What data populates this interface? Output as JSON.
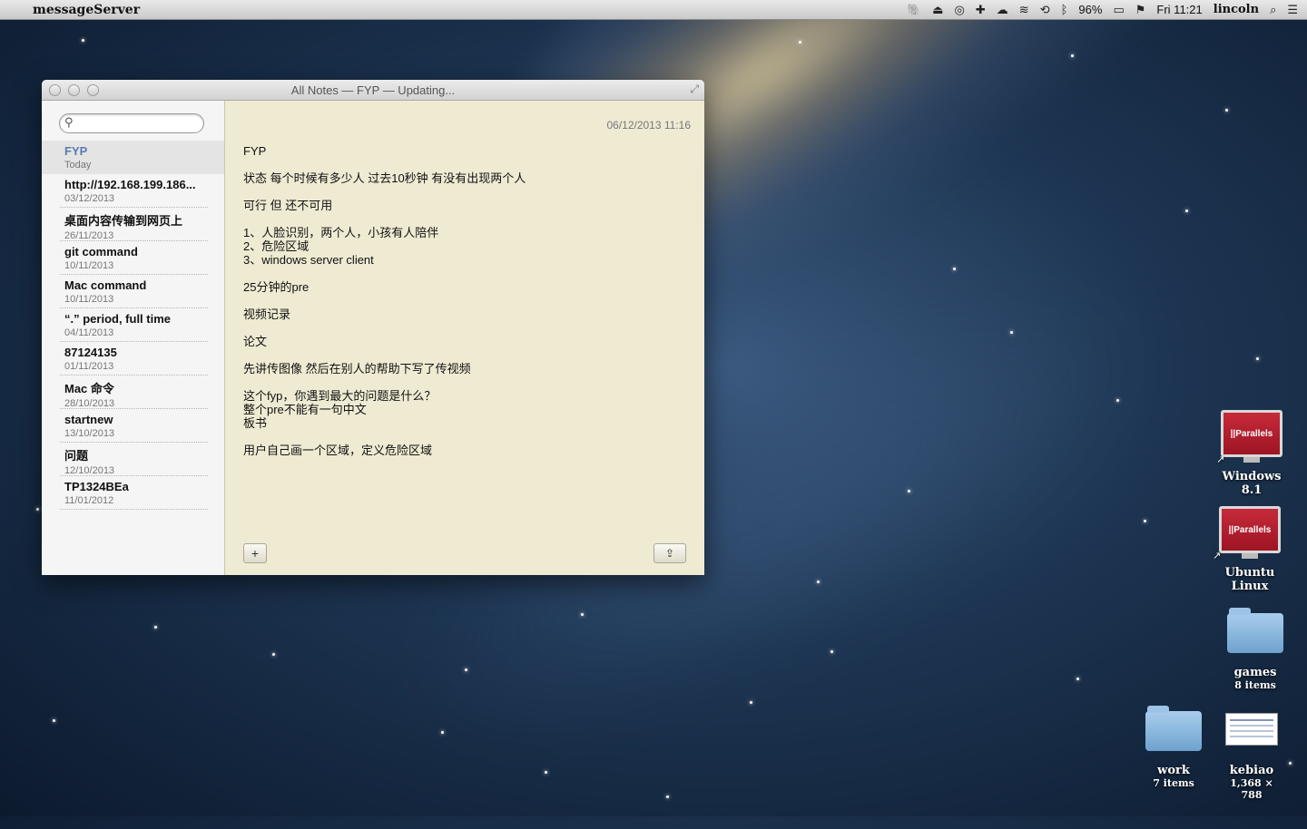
{
  "menubar": {
    "app_name": "messageServer",
    "battery": "96%",
    "clock": "Fri 11:21",
    "user": "lincoln"
  },
  "window": {
    "title": "All Notes — FYP — Updating...",
    "search_placeholder": "",
    "notes": [
      {
        "title": "FYP",
        "date": "Today"
      },
      {
        "title": "http://192.168.199.186...",
        "date": "03/12/2013"
      },
      {
        "title": "桌面内容传输到网页上",
        "date": "26/11/2013"
      },
      {
        "title": "git command",
        "date": "10/11/2013"
      },
      {
        "title": "Mac command",
        "date": "10/11/2013"
      },
      {
        "title": "“.” period, full time",
        "date": "04/11/2013"
      },
      {
        "title": "87124135",
        "date": "01/11/2013"
      },
      {
        "title": "Mac 命令",
        "date": "28/10/2013"
      },
      {
        "title": "startnew",
        "date": "13/10/2013"
      },
      {
        "title": "问题",
        "date": "12/10/2013"
      },
      {
        "title": "TP1324BEa",
        "date": "11/01/2012"
      }
    ],
    "note_timestamp": "06/12/2013 11:16",
    "note_lines": [
      "FYP",
      "",
      "状态 每个时候有多少人 过去10秒钟 有没有出现两个人",
      "",
      "可行 但 还不可用",
      "",
      "1、人脸识别，两个人，小孩有人陪伴",
      "2、危险区域",
      "3、windows server client",
      "",
      "25分钟的pre",
      "",
      "视频记录",
      "",
      "论文",
      "",
      "先讲传图像 然后在别人的帮助下写了传视频",
      "",
      "这个fyp，你遇到最大的问题是什么？",
      "整个pre不能有一句中文",
      "板书",
      "",
      "用户自己画一个区域，定义危险区域"
    ],
    "add_label": "+",
    "share_label": "⇪"
  },
  "desktop": {
    "icons": [
      {
        "label": "Windows 8.1",
        "badge": "||Parallels"
      },
      {
        "label": "Ubuntu Linux",
        "badge": "||Parallels"
      },
      {
        "label": "games",
        "sub": "8 items"
      },
      {
        "label": "work",
        "sub": "7 items"
      },
      {
        "label": "kebiao",
        "sub": "1,368 × 788"
      }
    ]
  }
}
